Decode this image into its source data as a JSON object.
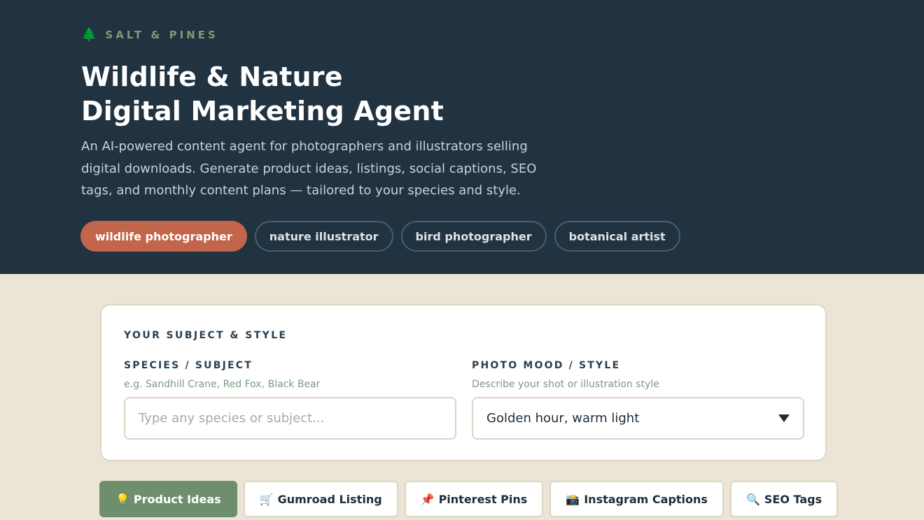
{
  "brand": {
    "icon": "tree-icon",
    "name": "SALT & PINES"
  },
  "hero": {
    "title_line1": "Wildlife & Nature",
    "title_line2": "Digital Marketing Agent",
    "description": "An AI-powered content agent for photographers and illustrators selling digital downloads. Generate product ideas, listings, social captions, SEO tags, and monthly content plans — tailored to your species and style."
  },
  "personas": [
    {
      "label": "wildlife photographer",
      "active": true
    },
    {
      "label": "nature illustrator",
      "active": false
    },
    {
      "label": "bird photographer",
      "active": false
    },
    {
      "label": "botanical artist",
      "active": false
    }
  ],
  "form": {
    "section_title": "YOUR SUBJECT & STYLE",
    "species": {
      "label": "SPECIES / SUBJECT",
      "hint": "e.g. Sandhill Crane, Red Fox, Black Bear",
      "placeholder": "Type any species or subject...",
      "value": ""
    },
    "mood": {
      "label": "PHOTO MOOD / STYLE",
      "hint": "Describe your shot or illustration style",
      "selected": "Golden hour, warm light"
    }
  },
  "tabs": [
    {
      "icon": "💡",
      "icon_name": "lightbulb-icon",
      "label": "Product Ideas",
      "active": true
    },
    {
      "icon": "🛒",
      "icon_name": "shopping-cart-icon",
      "label": "Gumroad Listing",
      "active": false
    },
    {
      "icon": "📌",
      "icon_name": "pushpin-icon",
      "label": "Pinterest Pins",
      "active": false
    },
    {
      "icon": "📸",
      "icon_name": "camera-flash-icon",
      "label": "Instagram Captions",
      "active": false
    },
    {
      "icon": "🔍",
      "icon_name": "magnifier-icon",
      "label": "SEO Tags",
      "active": false
    }
  ],
  "colors": {
    "hero_bg": "#213240",
    "page_bg": "#ece4d4",
    "accent_chip": "#c2654a",
    "accent_tab": "#6e8f6e",
    "brand_text": "#7e9a72"
  }
}
